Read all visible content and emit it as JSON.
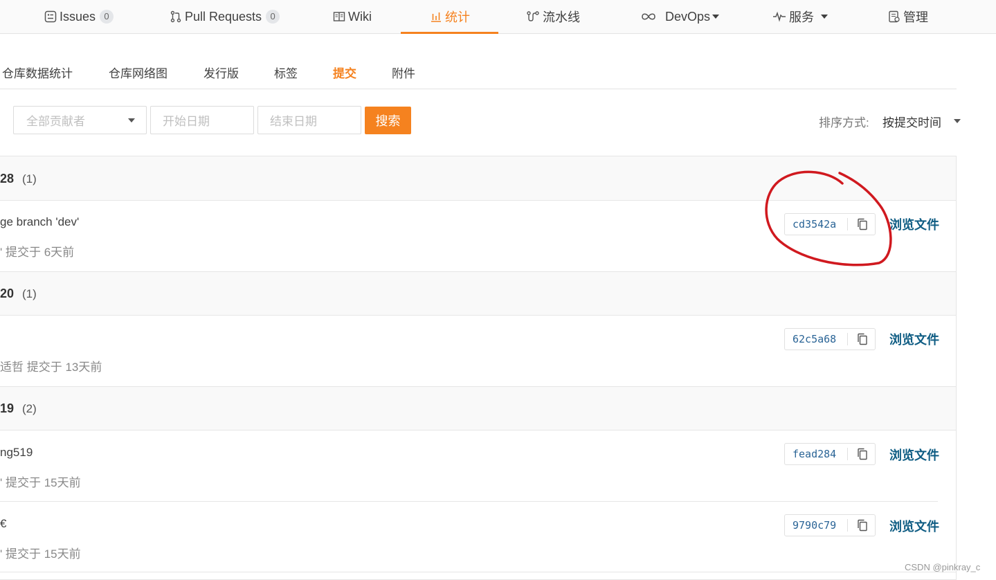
{
  "nav": {
    "issues_label": "Issues",
    "issues_count": "0",
    "pulls_label": "Pull Requests",
    "pulls_count": "0",
    "wiki_label": "Wiki",
    "stats_label": "统计",
    "pipeline_label": "流水线",
    "devops_label": "DevOps",
    "services_label": "服务",
    "manage_label": "管理",
    "accent_color": "#f5821f"
  },
  "subtabs": [
    "仓库数据统计",
    "仓库网络图",
    "发行版",
    "标签",
    "提交",
    "附件"
  ],
  "active_subtab": "提交",
  "filters": {
    "contributors_placeholder": "全部贡献者",
    "start_date_placeholder": "开始日期",
    "end_date_placeholder": "结束日期",
    "search_label": "搜索",
    "sort_label": "排序方式:",
    "sort_value": "按提交时间"
  },
  "groups": [
    {
      "date": "28",
      "count": "(1)",
      "commits": [
        {
          "message": "ge branch 'dev'",
          "meta": "' 提交于 6天前",
          "sha": "cd3542a",
          "browse": "浏览文件"
        }
      ]
    },
    {
      "date": "20",
      "count": "(1)",
      "commits": [
        {
          "message": "",
          "meta": "适哲 提交于 13天前",
          "sha": "62c5a68",
          "browse": "浏览文件"
        }
      ]
    },
    {
      "date": "19",
      "count": "(2)",
      "commits": [
        {
          "message": "ng519",
          "meta": "' 提交于 15天前",
          "sha": "fead284",
          "browse": "浏览文件"
        },
        {
          "message": "€",
          "meta": "' 提交于 15天前",
          "sha": "9790c79",
          "browse": "浏览文件"
        }
      ]
    }
  ],
  "watermark": "CSDN @pinkray_c",
  "annotation_color": "#d0191f"
}
